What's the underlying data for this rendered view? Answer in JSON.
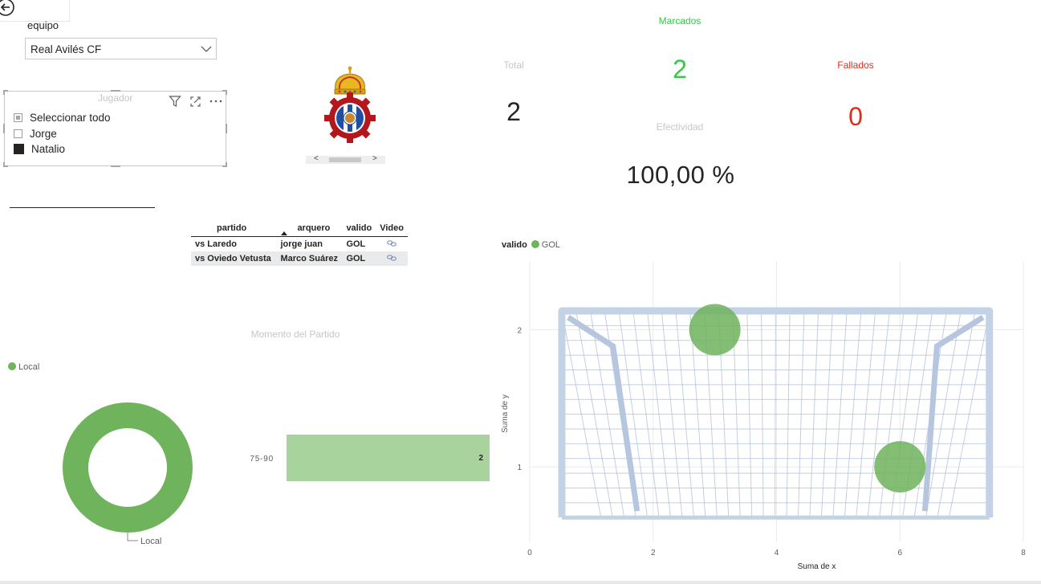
{
  "filters": {
    "equipo_label": "equipo",
    "equipo_value": "Real Avilés CF",
    "jugador_title": "Jugador",
    "jugador_items": [
      {
        "label": "Seleccionar todo",
        "state": "partial"
      },
      {
        "label": "Jorge",
        "state": "unchecked"
      },
      {
        "label": "Natalio",
        "state": "checked"
      }
    ]
  },
  "kpis": {
    "marcados_label": "Marcados",
    "marcados_value": "2",
    "total_label": "Total",
    "total_value": "2",
    "fallados_label": "Fallados",
    "fallados_value": "0",
    "efectividad_label": "Efectividad",
    "efectividad_value": "100,00 %",
    "marcados_color": "#2ecc40",
    "fallados_color": "#e02d1b"
  },
  "table": {
    "headers": [
      "partido",
      "arquero",
      "valido",
      "Video"
    ],
    "sorted_column": "arquero",
    "rows": [
      {
        "partido": "vs Laredo",
        "arquero": "jorge juan",
        "valido": "GOL",
        "video": "link-icon"
      },
      {
        "partido": "vs Oviedo Vetusta",
        "arquero": "Marco Suárez",
        "valido": "GOL",
        "video": "link-icon"
      }
    ]
  },
  "icons": {
    "back": "back-arrow-icon",
    "filter": "filter-icon",
    "focus": "focus-mode-icon",
    "more": "more-options-icon",
    "chevron": "chevron-down-icon",
    "link": "link-icon",
    "logo": "club-crest-logo",
    "goal": "goal-net-image"
  },
  "chart_data": [
    {
      "type": "pie",
      "variant": "donut",
      "legend": [
        "Local"
      ],
      "categories": [
        "Local"
      ],
      "values": [
        2
      ],
      "data_labels": [
        "Local"
      ],
      "legend_placement": "top-left",
      "colors": [
        "#6fb35d"
      ]
    },
    {
      "type": "bar",
      "orientation": "horizontal",
      "title": "Momento del Partido",
      "categories": [
        "75-90"
      ],
      "values": [
        2
      ],
      "data_labels": [
        "2"
      ],
      "colors": [
        "#a9d39c"
      ]
    },
    {
      "type": "scatter",
      "legend_title": "valido",
      "legend": [
        "GOL"
      ],
      "xlabel": "Suma de x",
      "ylabel": "Suma de y",
      "xlim": [
        0,
        8
      ],
      "ylim": [
        0.45,
        2.5
      ],
      "xticks": [
        0,
        2,
        4,
        6,
        8
      ],
      "yticks": [
        1,
        2
      ],
      "grid": true,
      "series": [
        {
          "name": "GOL",
          "x": [
            3,
            6
          ],
          "y": [
            2,
            1
          ]
        }
      ],
      "colors": [
        "#6fb35d"
      ]
    }
  ]
}
